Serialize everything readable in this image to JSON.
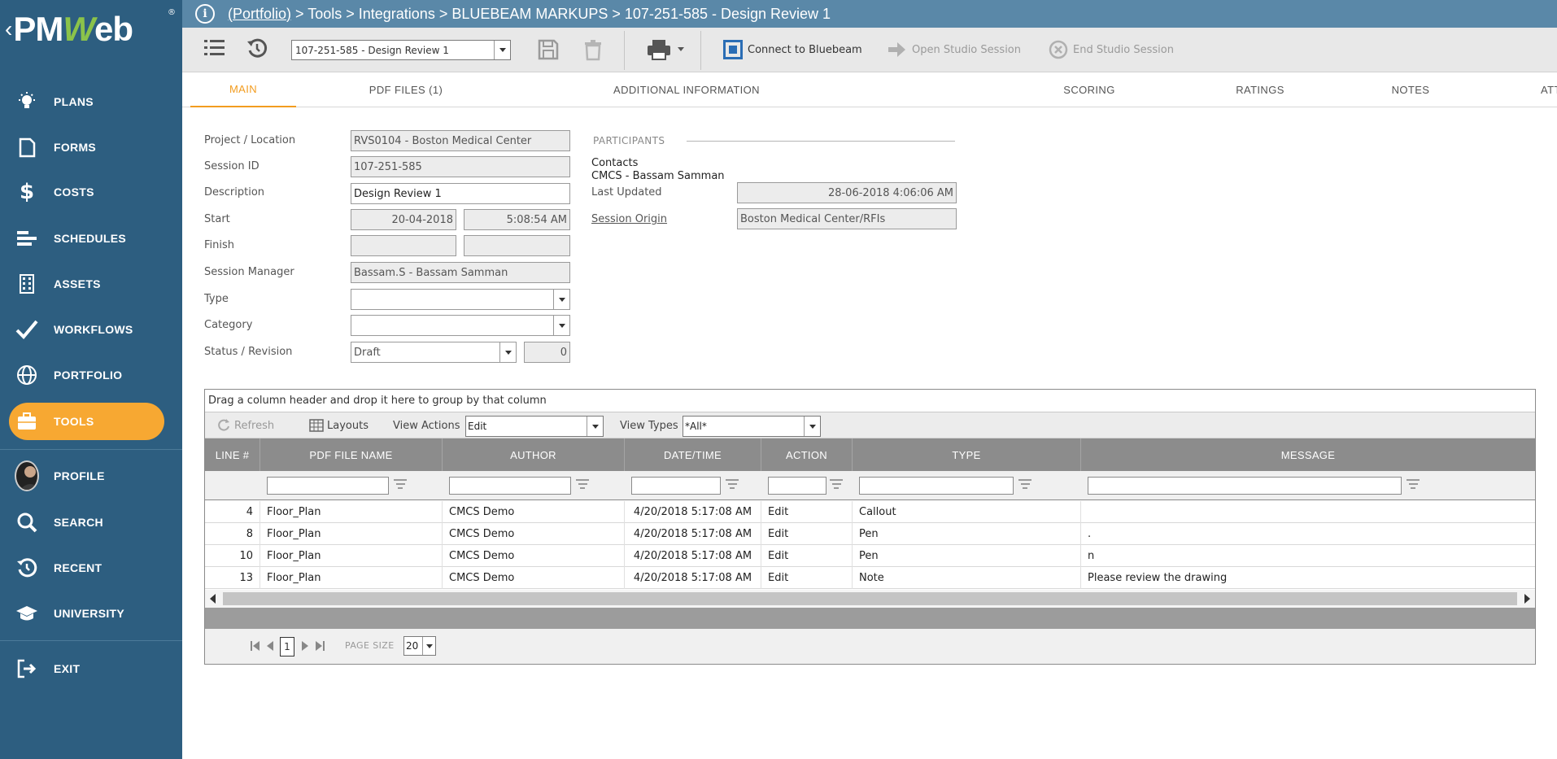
{
  "app": {
    "logo_prefix": "PM",
    "logo_w": "W",
    "logo_suffix": "eb",
    "logo_reg": "®"
  },
  "sidebar": {
    "items": [
      {
        "label": "PLANS",
        "icon": "lightbulb-icon"
      },
      {
        "label": "FORMS",
        "icon": "document-icon"
      },
      {
        "label": "COSTS",
        "icon": "dollar-icon"
      },
      {
        "label": "SCHEDULES",
        "icon": "bars-icon"
      },
      {
        "label": "ASSETS",
        "icon": "building-icon"
      },
      {
        "label": "WORKFLOWS",
        "icon": "checkmark-icon"
      },
      {
        "label": "PORTFOLIO",
        "icon": "globe-icon"
      },
      {
        "label": "TOOLS",
        "icon": "briefcase-icon",
        "active": true
      },
      {
        "label": "PROFILE",
        "icon": "avatar-icon"
      },
      {
        "label": "SEARCH",
        "icon": "search-icon"
      },
      {
        "label": "RECENT",
        "icon": "history-icon"
      },
      {
        "label": "UNIVERSITY",
        "icon": "graduation-cap-icon"
      },
      {
        "label": "EXIT",
        "icon": "exit-icon"
      }
    ],
    "active_color": "#f7a832",
    "background": "#2d5e80"
  },
  "breadcrumb": {
    "link": "(Portfolio)",
    "rest": " > Tools > Integrations > BLUEBEAM MARKUPS > 107-251-585 - Design Review 1"
  },
  "toolbar": {
    "record_select": "107-251-585 - Design Review 1",
    "connect_label": "Connect to Bluebeam",
    "open_session_label": "Open Studio Session",
    "end_session_label": "End Studio Session"
  },
  "tabs": [
    {
      "label": "MAIN",
      "active": true
    },
    {
      "label": "PDF FILES (1)"
    },
    {
      "label": "ADDITIONAL INFORMATION"
    },
    {
      "label": "SCORING"
    },
    {
      "label": "RATINGS"
    },
    {
      "label": "NOTES"
    },
    {
      "label": "ATTACHMENTS"
    }
  ],
  "form": {
    "project_label": "Project / Location",
    "project_value": "RVS0104 - Boston Medical Center",
    "session_id_label": "Session ID",
    "session_id_value": "107-251-585",
    "description_label": "Description",
    "description_value": "Design Review 1",
    "start_label": "Start",
    "start_date": "20-04-2018",
    "start_time": "5:08:54 AM",
    "finish_label": "Finish",
    "finish_date": "",
    "finish_time": "",
    "manager_label": "Session Manager",
    "manager_value": "Bassam.S - Bassam Samman",
    "type_label": "Type",
    "type_value": "",
    "category_label": "Category",
    "category_value": "",
    "status_label": "Status / Revision",
    "status_value": "Draft",
    "revision_value": "0"
  },
  "participants": {
    "title": "PARTICIPANTS",
    "contacts_label": "Contacts",
    "contacts_value": "CMCS - Bassam Samman",
    "last_updated_label": "Last Updated",
    "last_updated_value": "28-06-2018 4:06:06 AM",
    "origin_label": "Session Origin",
    "origin_value": "Boston Medical Center/RFIs"
  },
  "grid": {
    "group_hint": "Drag a column header and drop it here to group by that column",
    "refresh_label": "Refresh",
    "layouts_label": "Layouts",
    "view_actions_label": "View Actions",
    "view_actions_value": "Edit",
    "view_types_label": "View Types",
    "view_types_value": "*All*",
    "columns": [
      "LINE #",
      "PDF FILE NAME",
      "AUTHOR",
      "DATE/TIME",
      "ACTION",
      "TYPE",
      "MESSAGE"
    ],
    "rows": [
      {
        "line": "4",
        "file": "Floor_Plan",
        "author": "CMCS Demo",
        "datetime": "4/20/2018 5:17:08 AM",
        "action": "Edit",
        "type": "Callout",
        "message": ""
      },
      {
        "line": "8",
        "file": "Floor_Plan",
        "author": "CMCS Demo",
        "datetime": "4/20/2018 5:17:08 AM",
        "action": "Edit",
        "type": "Pen",
        "message": "."
      },
      {
        "line": "10",
        "file": "Floor_Plan",
        "author": "CMCS Demo",
        "datetime": "4/20/2018 5:17:08 AM",
        "action": "Edit",
        "type": "Pen",
        "message": "n"
      },
      {
        "line": "13",
        "file": "Floor_Plan",
        "author": "CMCS Demo",
        "datetime": "4/20/2018 5:17:08 AM",
        "action": "Edit",
        "type": "Note",
        "message": "Please review the drawing"
      }
    ],
    "page_number": "1",
    "page_size_label": "PAGE SIZE",
    "page_size_value": "20"
  }
}
